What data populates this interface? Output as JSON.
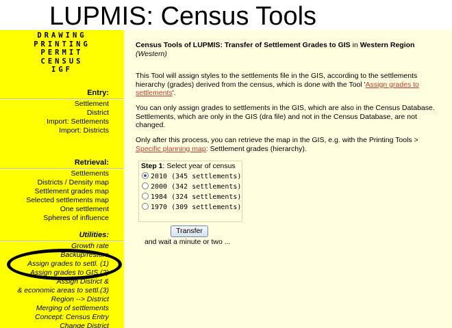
{
  "slide_title": "LUPMIS: Census Tools",
  "sidebar": {
    "top_nav": [
      "DRAWING",
      "PRINTING",
      "PERMIT",
      "CENSUS",
      "IGF"
    ],
    "entry": {
      "heading": "Entry:",
      "items": [
        "Settlement",
        "District",
        "Import: Settlements",
        "Import: Districts"
      ]
    },
    "retrieval": {
      "heading": "Retrieval:",
      "items": [
        "Settlements",
        "Districts / Density map",
        "Settlement grades map",
        "Selected settlements map",
        "One settlement",
        "Spheres of influence"
      ]
    },
    "utilities": {
      "heading": "Utilities:",
      "items": [
        "Growth rate",
        "Backup/restore",
        "Assign grades to settl. (1)",
        "Assign grades to GIS (2)",
        "Assign District &",
        "& economic areas to settl.(3)",
        "Region --> District",
        "Merging of settlements",
        "Concept: Census Entry",
        "Change District"
      ]
    }
  },
  "main": {
    "title_prefix": "Census Tools of LUPMIS: Transfer of Settlement Grades to GIS",
    "title_in": " in ",
    "region": "Western Region",
    "region_sub": "(Western)",
    "para1_a": "This Tool will assign styles to the settlements file in the GIS, according to the settlements hierarchy (grades) derived from the census, which is done with the Tool '",
    "para1_link": "Assign grades to settlements",
    "para1_b": "'.",
    "para2": "You can only assign grades to settlements in the GIS, which are also in the Census Database. Settlements, which are only in the GIS (dra file) and not in the Census Database, are not changed.",
    "para3_a": "Only after this process, you can retrieve the map in the GIS, e.g. with the Printing Tools > ",
    "para3_link": "Specific planning map",
    "para3_b": ": Settlement grades (hierarchy).",
    "step_bold": "Step 1",
    "step_rest": ": Select year of census",
    "options": [
      {
        "label": "2010 (345 settlements)",
        "selected": true
      },
      {
        "label": "2000 (342 settlements)",
        "selected": false
      },
      {
        "label": "1984 (324 settlements)",
        "selected": false
      },
      {
        "label": "1970 (309 settlements)",
        "selected": false
      }
    ],
    "transfer_label": "Transfer",
    "wait_text": "and wait a minute or two ..."
  },
  "colors": {
    "sidebar_bg": "#ffff00",
    "main_bg": "#ffffe0",
    "link": "#c0392b",
    "annotation": "#000000"
  }
}
